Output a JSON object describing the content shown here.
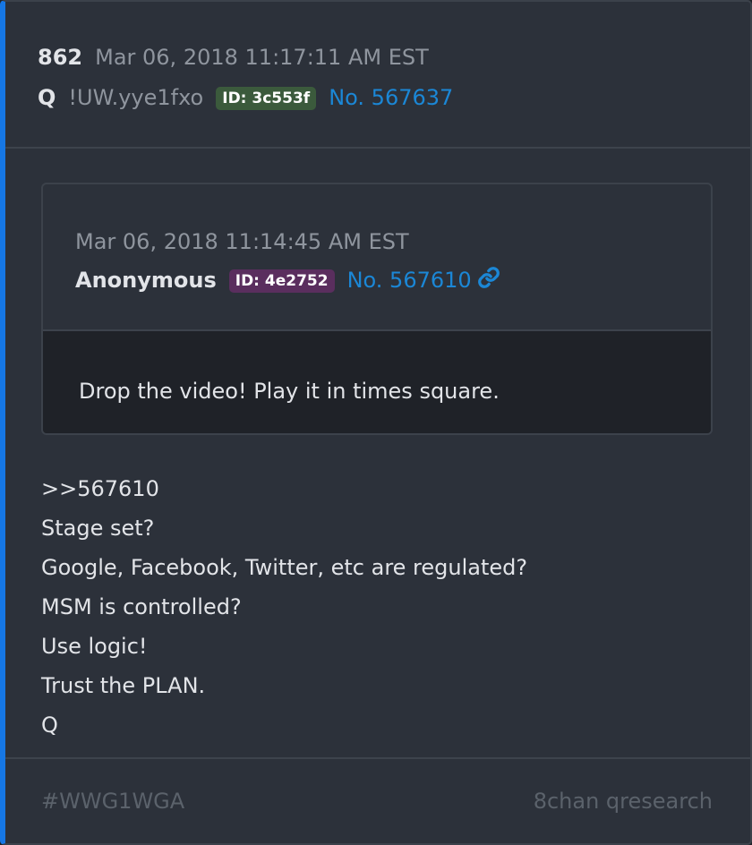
{
  "post": {
    "number": "862",
    "date": "Mar 06, 2018 11:17:11 AM EST",
    "author": "Q",
    "tripcode": "!UW.yye1fxo",
    "id_badge": "ID: 3c553f",
    "post_no": "No. 567637"
  },
  "quoted": {
    "date": "Mar 06, 2018 11:14:45 AM EST",
    "author": "Anonymous",
    "id_badge": "ID: 4e2752",
    "post_no": "No. 567610",
    "text": "Drop the video! Play it in times square."
  },
  "body": {
    "lines": [
      ">>567610",
      "Stage set?",
      "Google, Facebook, Twitter, etc are regulated?",
      "MSM is controlled?",
      "Use logic!",
      "Trust the PLAN.",
      "Q"
    ]
  },
  "footer": {
    "hashtag": "#WWG1WGA",
    "source": "8chan qresearch"
  },
  "icons": {
    "link": "link-icon"
  },
  "colors": {
    "accent": "#1677e5",
    "link": "#1b87d6",
    "id_green": "#3b5a3c",
    "id_purple": "#5a2e5e"
  }
}
